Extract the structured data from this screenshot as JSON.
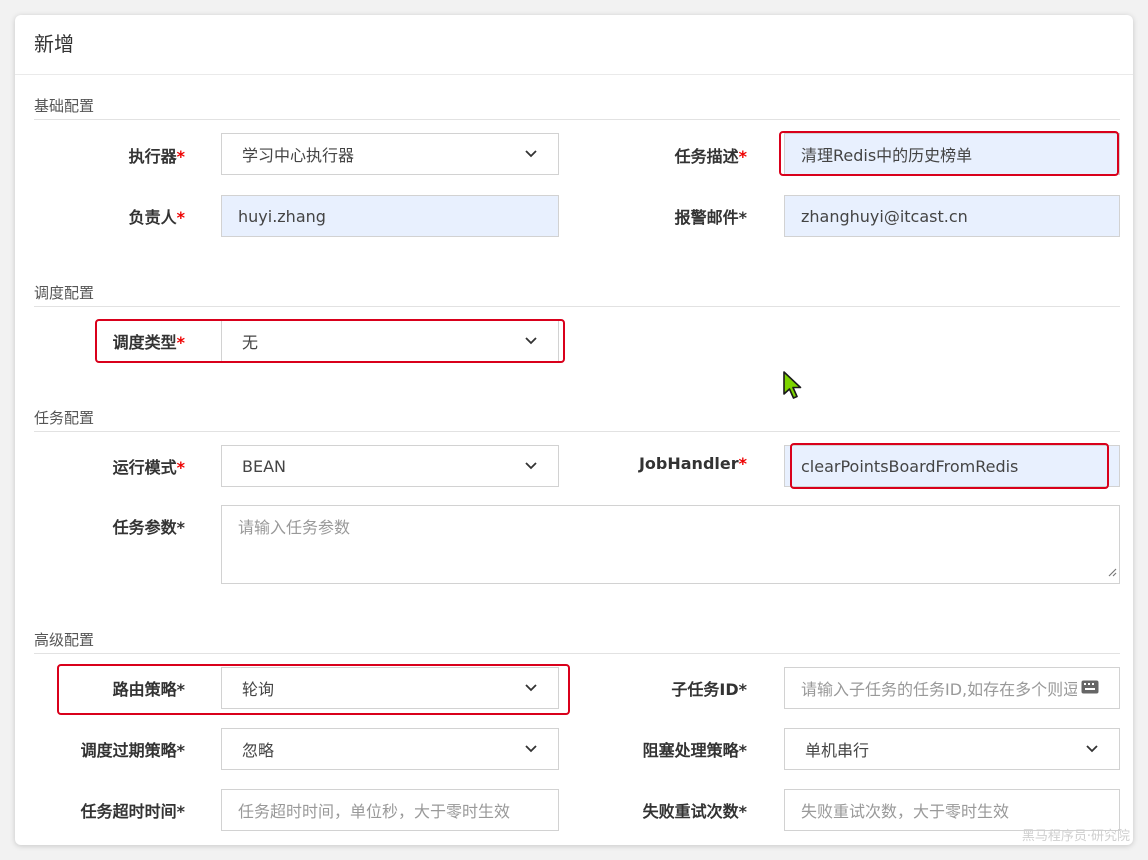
{
  "dialog": {
    "title": "新增"
  },
  "sections": {
    "basic": "基础配置",
    "schedule": "调度配置",
    "task": "任务配置",
    "advanced": "高级配置"
  },
  "fields": {
    "executor": {
      "label": "执行器",
      "required_mark": "*",
      "value": "学习中心执行器"
    },
    "job_desc": {
      "label": "任务描述",
      "required_mark": "*",
      "value": "清理Redis中的历史榜单"
    },
    "author": {
      "label": "负责人",
      "required_mark": "*",
      "value": "huyi.zhang"
    },
    "alarm_email": {
      "label": "报警邮件",
      "required_mark": "*",
      "value": "zhanghuyi@itcast.cn"
    },
    "schedule_type": {
      "label": "调度类型",
      "required_mark": "*",
      "value": "无"
    },
    "glue_type": {
      "label": "运行模式",
      "required_mark": "*",
      "value": "BEAN"
    },
    "job_handler": {
      "label": "JobHandler",
      "required_mark": "*",
      "value": "clearPointsBoardFromRedis"
    },
    "job_param": {
      "label": "任务参数",
      "required_mark": "*",
      "placeholder": "请输入任务参数"
    },
    "route_strategy": {
      "label": "路由策略",
      "required_mark": "*",
      "value": "轮询"
    },
    "child_job_id": {
      "label": "子任务ID",
      "required_mark": "*",
      "placeholder": "请输入子任务的任务ID,如存在多个则逗"
    },
    "misfire_strategy": {
      "label": "调度过期策略",
      "required_mark": "*",
      "value": "忽略"
    },
    "block_strategy": {
      "label": "阻塞处理策略",
      "required_mark": "*",
      "value": "单机串行"
    },
    "timeout": {
      "label": "任务超时时间",
      "required_mark": "*",
      "placeholder": "任务超时时间，单位秒，大于零时生效"
    },
    "fail_retry": {
      "label": "失败重试次数",
      "required_mark": "*",
      "placeholder": "失败重试次数，大于零时生效"
    }
  },
  "watermark": "黑马程序员·研究院",
  "colors": {
    "highlight": "#d9001b",
    "required": "#e00000",
    "autofill": "#e8f0fe",
    "cursor": "#7dd400"
  }
}
